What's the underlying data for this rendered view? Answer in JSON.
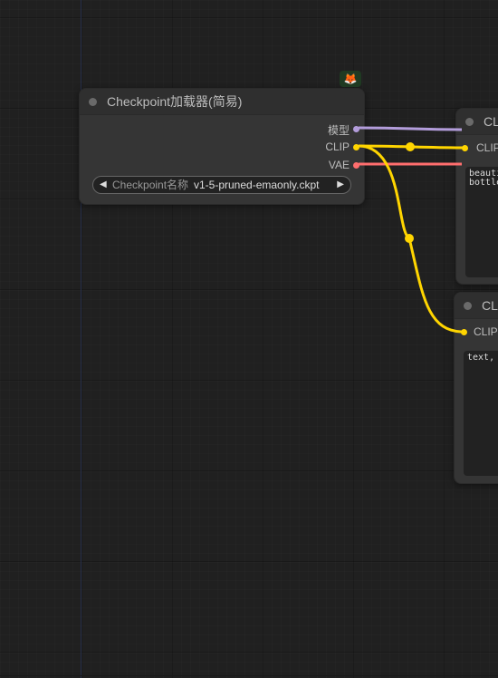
{
  "canvas": {
    "background": "#202020"
  },
  "badge": {
    "icon": "fox-icon",
    "glyph": "🦊"
  },
  "checkpoint_node": {
    "title": "Checkpoint加载器(简易)",
    "outputs": [
      {
        "label": "模型",
        "color": "#b39ddb"
      },
      {
        "label": "CLIP",
        "color": "#ffd500"
      },
      {
        "label": "VAE",
        "color": "#ff6e6e"
      }
    ],
    "widget": {
      "label": "Checkpoint名称",
      "value": "v1-5-pruned-emaonly.ckpt",
      "left_arrow": "◀",
      "right_arrow": "▶"
    }
  },
  "clip_node_1": {
    "title": "CL",
    "input_label": "CLIP",
    "text": "beauti\nbottle"
  },
  "clip_node_2": {
    "title": "CL",
    "input_label": "CLIP",
    "text": "text,"
  },
  "link_colors": {
    "model": "#b39ddb",
    "clip": "#ffd500",
    "vae": "#ff6e6e"
  }
}
